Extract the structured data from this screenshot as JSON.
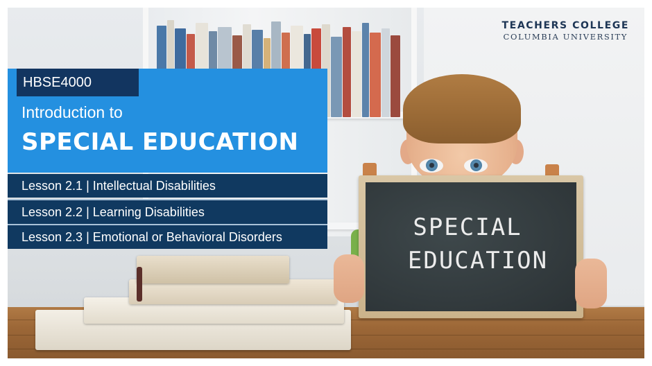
{
  "logo": {
    "line1": "TEACHERS COLLEGE",
    "line2": "COLUMBIA UNIVERSITY"
  },
  "course": {
    "code": "HBSE4000",
    "intro": "Introduction to",
    "title": "SPECIAL EDUCATION"
  },
  "lessons": [
    {
      "label": "Lesson 2.1 | Intellectual Disabilities"
    },
    {
      "label": "Lesson 2.2 | Learning Disabilities"
    },
    {
      "label": "Lesson 2.3 | Emotional or Behavioral Disorders"
    }
  ],
  "chalkboard": {
    "line1": "SPECIAL",
    "line2": "EDUCATION"
  },
  "colors": {
    "panel_blue": "#2490e0",
    "dark_navy": "#103960",
    "logo_navy": "#1d3555"
  }
}
